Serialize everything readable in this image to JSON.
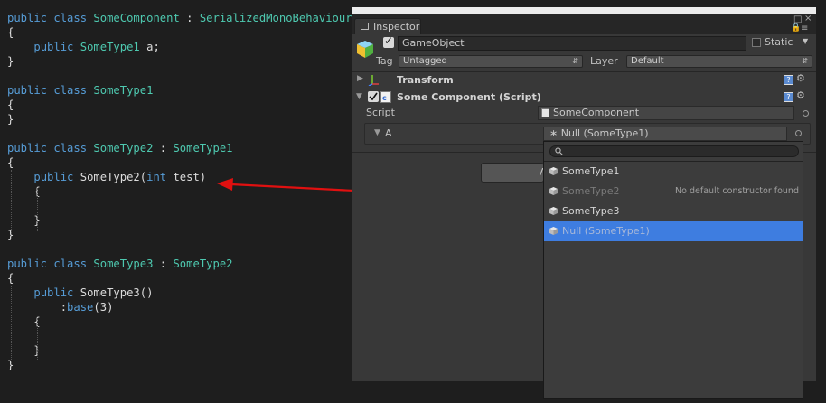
{
  "code": {
    "lines": [
      [
        "kw:public ",
        "kw:class ",
        "ty:SomeComponent",
        "tx: : ",
        "ty:SerializedMonoBehaviour"
      ],
      [
        "tx:{"
      ],
      [
        "tx:    ",
        "kw:public ",
        "ty:SomeType1",
        "tx: a;"
      ],
      [
        "tx:}"
      ],
      [],
      [
        "kw:public ",
        "kw:class ",
        "ty:SomeType1"
      ],
      [
        "tx:{"
      ],
      [
        "tx:}"
      ],
      [],
      [
        "kw:public ",
        "kw:class ",
        "ty:SomeType2",
        "tx: : ",
        "ty:SomeType1"
      ],
      [
        "tx:{"
      ],
      [
        "tx:    ",
        "kw:public ",
        "tx:SomeType2(",
        "kw:int",
        "tx: test)"
      ],
      [
        "tx:    {"
      ],
      [],
      [
        "tx:    }"
      ],
      [
        "tx:}"
      ],
      [],
      [
        "kw:public ",
        "kw:class ",
        "ty:SomeType3",
        "tx: : ",
        "ty:SomeType2"
      ],
      [
        "tx:{"
      ],
      [
        "tx:    ",
        "kw:public ",
        "tx:SomeType3()"
      ],
      [
        "tx:        :",
        "kw:base",
        "tx:(3)"
      ],
      [
        "tx:    {"
      ],
      [],
      [
        "tx:    }"
      ],
      [
        "tx:}"
      ]
    ]
  },
  "inspector": {
    "tab_label": "Inspector",
    "gameobject_name": "GameObject",
    "static_label": "Static",
    "tag_label": "Tag",
    "tag_value": "Untagged",
    "layer_label": "Layer",
    "layer_value": "Default",
    "transform_label": "Transform",
    "component_label": "Some Component (Script)",
    "script_label": "Script",
    "script_value": "SomeComponent",
    "field_a_label": "A",
    "field_a_value": "Null (SomeType1)",
    "add_button_partial": "A"
  },
  "dropdown": {
    "search_value": "",
    "items": [
      {
        "label": "SomeType1",
        "note": "",
        "state": "normal"
      },
      {
        "label": "SomeType2",
        "note": "No default constructor found",
        "state": "disabled"
      },
      {
        "label": "SomeType3",
        "note": "",
        "state": "normal"
      },
      {
        "label": "Null (SomeType1)",
        "note": "",
        "state": "selected"
      }
    ]
  },
  "colors": {
    "keyword": "#569cd6",
    "type": "#4ec9b0",
    "arrow": "#e01010",
    "selection": "#3e7de0"
  }
}
